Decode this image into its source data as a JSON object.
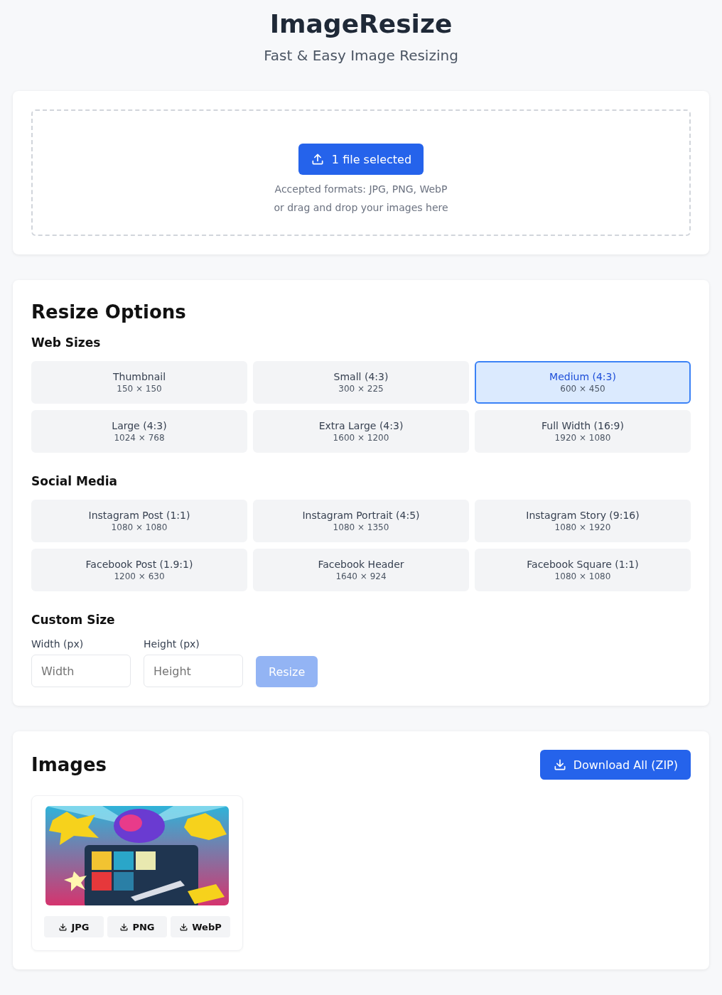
{
  "header": {
    "title": "ImageResize",
    "subtitle": "Fast & Easy Image Resizing"
  },
  "upload": {
    "button": "1 file selected",
    "formats": "Accepted formats: JPG, PNG, WebP",
    "hint": "or drag and drop your images here"
  },
  "options": {
    "title": "Resize Options",
    "groups": [
      {
        "heading": "Web Sizes",
        "presets": [
          {
            "label": "Thumbnail",
            "size": "150 × 150",
            "selected": false
          },
          {
            "label": "Small (4:3)",
            "size": "300 × 225",
            "selected": false
          },
          {
            "label": "Medium (4:3)",
            "size": "600 × 450",
            "selected": true
          },
          {
            "label": "Large (4:3)",
            "size": "1024 × 768",
            "selected": false
          },
          {
            "label": "Extra Large (4:3)",
            "size": "1600 × 1200",
            "selected": false
          },
          {
            "label": "Full Width (16:9)",
            "size": "1920 × 1080",
            "selected": false
          }
        ]
      },
      {
        "heading": "Social Media",
        "presets": [
          {
            "label": "Instagram Post (1:1)",
            "size": "1080 × 1080",
            "selected": false
          },
          {
            "label": "Instagram Portrait (4:5)",
            "size": "1080 × 1350",
            "selected": false
          },
          {
            "label": "Instagram Story (9:16)",
            "size": "1080 × 1920",
            "selected": false
          },
          {
            "label": "Facebook Post (1.9:1)",
            "size": "1200 × 630",
            "selected": false
          },
          {
            "label": "Facebook Header",
            "size": "1640 × 924",
            "selected": false
          },
          {
            "label": "Facebook Square (1:1)",
            "size": "1080 × 1080",
            "selected": false
          }
        ]
      }
    ],
    "custom": {
      "heading": "Custom Size",
      "fields": [
        {
          "label": "Width (px)",
          "placeholder": "Width"
        },
        {
          "label": "Height (px)",
          "placeholder": "Height"
        }
      ],
      "button": {
        "label": "Resize",
        "disabled": true
      }
    }
  },
  "images": {
    "title": "Images",
    "download_all": "Download All (ZIP)",
    "items": [
      {
        "kind": "picture",
        "formats": [
          "JPG",
          "PNG",
          "WebP"
        ]
      }
    ]
  }
}
